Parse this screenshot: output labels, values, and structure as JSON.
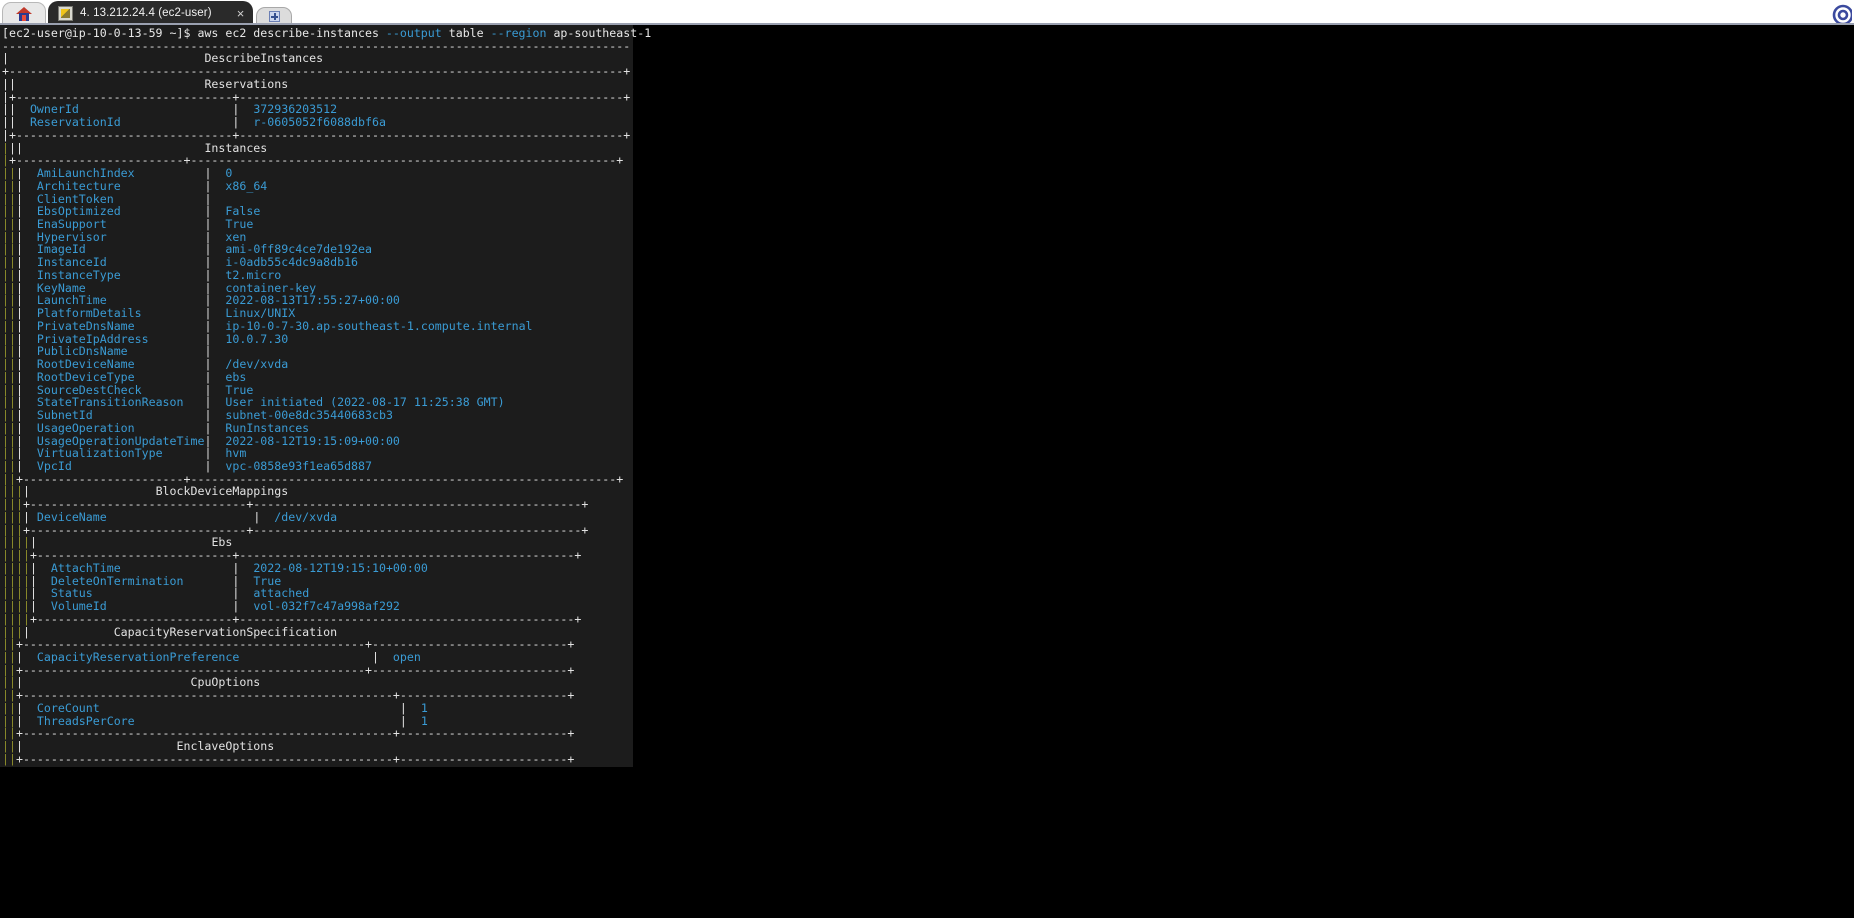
{
  "chrome": {
    "home_tab": {
      "icon": "home-icon",
      "label": ""
    },
    "active_tab": {
      "icon": "putty-terminal-icon",
      "title": "4. 13.212.24.4 (ec2-user)",
      "close_label": "×"
    },
    "new_tab": {
      "icon": "plus-icon",
      "label": ""
    },
    "corner_icon": "app-logo-icon"
  },
  "terminal": {
    "prompt": "[ec2-user@ip-10-0-13-59 ~]$ ",
    "command": "aws ec2 describe-instances ",
    "flag_output": "--output",
    "arg_output": " table ",
    "flag_region": "--region",
    "arg_region": " ap-southeast-1",
    "tables": {
      "root_title": "DescribeInstances",
      "reservations_title": "Reservations",
      "instances_title": "Instances",
      "blockdevicemappings_title": "BlockDeviceMappings",
      "ebs_title": "Ebs",
      "capacityreservationspecification_title": "CapacityReservationSpecification",
      "cpuoptions_title": "CpuOptions",
      "enclaveoptions_title": "EnclaveOptions"
    },
    "reservations_rows": [
      {
        "key": "OwnerId",
        "value": "372936203512"
      },
      {
        "key": "ReservationId",
        "value": "r-0605052f6088dbf6a"
      }
    ],
    "instances_rows": [
      {
        "key": "AmiLaunchIndex",
        "value": "0"
      },
      {
        "key": "Architecture",
        "value": "x86_64"
      },
      {
        "key": "ClientToken",
        "value": ""
      },
      {
        "key": "EbsOptimized",
        "value": "False"
      },
      {
        "key": "EnaSupport",
        "value": "True"
      },
      {
        "key": "Hypervisor",
        "value": "xen"
      },
      {
        "key": "ImageId",
        "value": "ami-0ff89c4ce7de192ea"
      },
      {
        "key": "InstanceId",
        "value": "i-0adb55c4dc9a8db16"
      },
      {
        "key": "InstanceType",
        "value": "t2.micro"
      },
      {
        "key": "KeyName",
        "value": "container-key"
      },
      {
        "key": "LaunchTime",
        "value": "2022-08-13T17:55:27+00:00"
      },
      {
        "key": "PlatformDetails",
        "value": "Linux/UNIX"
      },
      {
        "key": "PrivateDnsName",
        "value": "ip-10-0-7-30.ap-southeast-1.compute.internal"
      },
      {
        "key": "PrivateIpAddress",
        "value": "10.0.7.30"
      },
      {
        "key": "PublicDnsName",
        "value": ""
      },
      {
        "key": "RootDeviceName",
        "value": "/dev/xvda"
      },
      {
        "key": "RootDeviceType",
        "value": "ebs"
      },
      {
        "key": "SourceDestCheck",
        "value": "True"
      },
      {
        "key": "StateTransitionReason",
        "value": "User initiated (2022-08-17 11:25:38 GMT)"
      },
      {
        "key": "SubnetId",
        "value": "subnet-00e8dc35440683cb3"
      },
      {
        "key": "UsageOperation",
        "value": "RunInstances"
      },
      {
        "key": "UsageOperationUpdateTime",
        "value": "2022-08-12T19:15:09+00:00"
      },
      {
        "key": "VirtualizationType",
        "value": "hvm"
      },
      {
        "key": "VpcId",
        "value": "vpc-0858e93f1ea65d887"
      }
    ],
    "blockdevicemappings_rows": [
      {
        "key": "DeviceName",
        "value": "/dev/xvda"
      }
    ],
    "ebs_rows": [
      {
        "key": "AttachTime",
        "value": "2022-08-12T19:15:10+00:00"
      },
      {
        "key": "DeleteOnTermination",
        "value": "True"
      },
      {
        "key": "Status",
        "value": "attached"
      },
      {
        "key": "VolumeId",
        "value": "vol-032f7c47a998af292"
      }
    ],
    "capacityreservationspecification_rows": [
      {
        "key": "CapacityReservationPreference",
        "value": "open"
      }
    ],
    "cpuoptions_rows": [
      {
        "key": "CoreCount",
        "value": "1"
      },
      {
        "key": "ThreadsPerCore",
        "value": "1"
      }
    ]
  }
}
